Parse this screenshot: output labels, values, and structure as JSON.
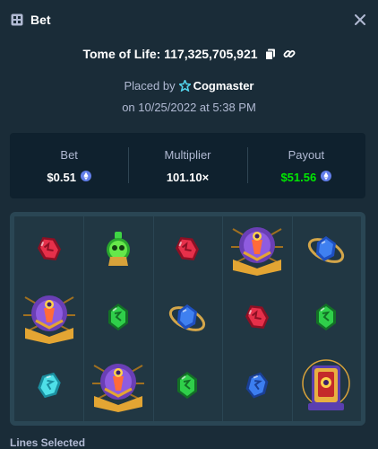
{
  "header": {
    "title": "Bet",
    "icon": "bet-slip-icon",
    "close_icon": "close-icon"
  },
  "game": {
    "name": "Tome of Life: 117,325,705,921",
    "copy_icon": "copy-icon",
    "link_icon": "link-icon"
  },
  "placed": {
    "prefix": "Placed by",
    "user": "Cogmaster",
    "user_icon": "star-badge-icon"
  },
  "date": "on 10/25/2022 at 5:38 PM",
  "stats": {
    "bet_label": "Bet",
    "bet_value": "$0.51",
    "multiplier_label": "Multiplier",
    "multiplier_value": "101.10×",
    "payout_label": "Payout",
    "payout_value": "$51.56",
    "currency_icon": "ethereum-icon"
  },
  "board": {
    "rows": [
      [
        "red-gem",
        "green-potion",
        "red-gem",
        "purple-book",
        "blue-gem-ring"
      ],
      [
        "purple-book",
        "green-gem",
        "blue-gem-ring",
        "red-gem",
        "green-gem"
      ],
      [
        "cyan-gem",
        "purple-book",
        "green-gem",
        "blue-gem",
        "red-tome-scatter"
      ]
    ]
  },
  "lines_selected_label": "Lines Selected",
  "colors": {
    "background": "#1a2c38",
    "panel": "#0f212e",
    "board": "#213743",
    "muted_text": "#b1bad3",
    "payout_green": "#00e701"
  }
}
